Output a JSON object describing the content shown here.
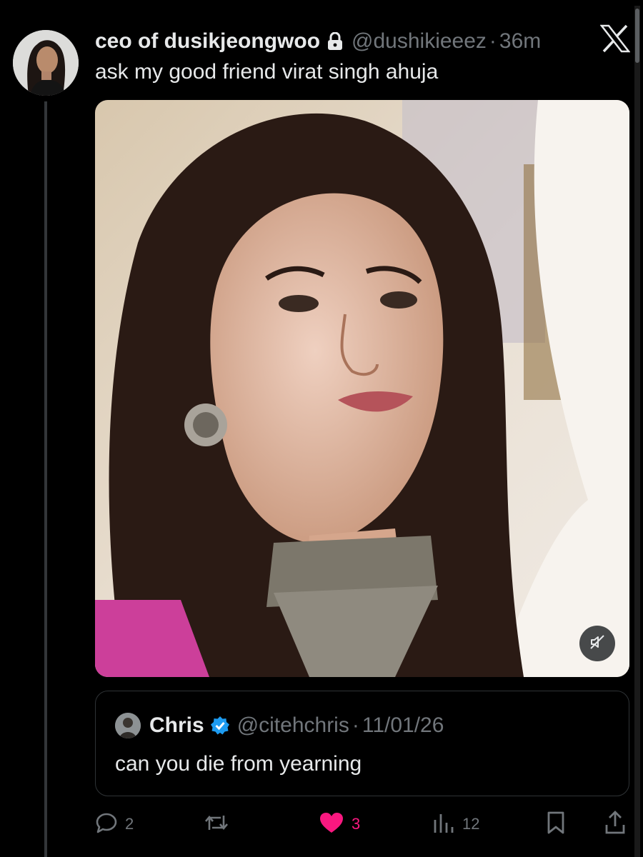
{
  "post": {
    "display_name": "ceo of dusikjeongwoo",
    "handle": "@dushikieeez",
    "separator": "·",
    "time": "36m",
    "text": "ask my good friend virat singh ahuja",
    "locked": true
  },
  "media": {
    "type": "video",
    "muted": true,
    "mute_icon": "speaker-muted-icon"
  },
  "quote": {
    "display_name": "Chris",
    "verified": true,
    "handle": "@citehchris",
    "separator": "·",
    "date": "11/01/26",
    "text": "can you die from yearning"
  },
  "actions": {
    "replies": "2",
    "reposts": "",
    "likes": "3",
    "liked": true,
    "views": "12"
  },
  "colors": {
    "background": "#000000",
    "text_primary": "#e7e9ea",
    "text_secondary": "#71767b",
    "like_accent": "#f91880",
    "verified_blue": "#1d9bf0",
    "border": "#2f3336"
  },
  "icons": [
    "lock-icon",
    "x-logo-icon",
    "verified-badge-icon",
    "reply-icon",
    "repost-icon",
    "heart-icon",
    "views-icon",
    "bookmark-icon",
    "share-icon",
    "speaker-muted-icon"
  ]
}
